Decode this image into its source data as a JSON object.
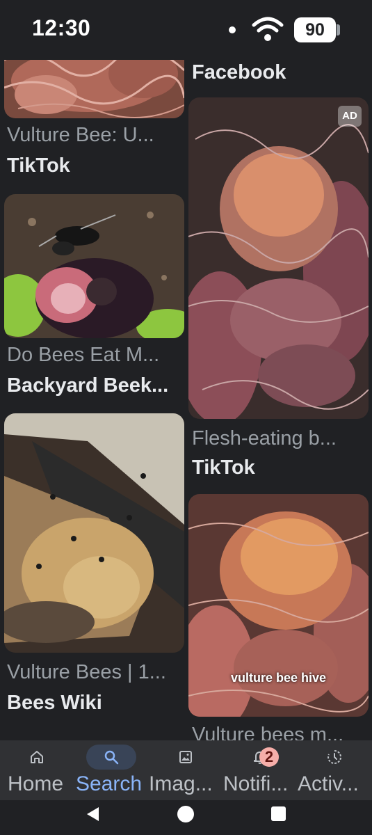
{
  "status_bar": {
    "time": "12:30",
    "battery": "90"
  },
  "feed": {
    "left": [
      {
        "title": "Vulture Bee: U...",
        "source": "TikTok"
      },
      {
        "title": "Do Bees Eat M...",
        "source": "Backyard Beek..."
      },
      {
        "title": "Vulture Bees | 1...",
        "source": "Bees Wiki"
      }
    ],
    "right": [
      {
        "title": "",
        "source": "Facebook"
      },
      {
        "title": "Flesh-eating b...",
        "source": "TikTok",
        "badge": "AD"
      },
      {
        "title": "Vulture bees m...",
        "source": "",
        "caption": "vulture bee hive"
      }
    ]
  },
  "bottom_nav": {
    "items": [
      {
        "label": "Home",
        "icon": "home-icon",
        "active": false
      },
      {
        "label": "Search",
        "icon": "search-icon",
        "active": true
      },
      {
        "label": "Imag...",
        "icon": "images-icon",
        "active": false
      },
      {
        "label": "Notifi...",
        "icon": "bell-icon",
        "active": false,
        "badge": "2"
      },
      {
        "label": "Activ...",
        "icon": "activity-icon",
        "active": false
      }
    ]
  },
  "colors": {
    "background": "#202124",
    "nav_background": "#303134",
    "accent": "#8ab4f8",
    "badge": "#f6aea9"
  }
}
